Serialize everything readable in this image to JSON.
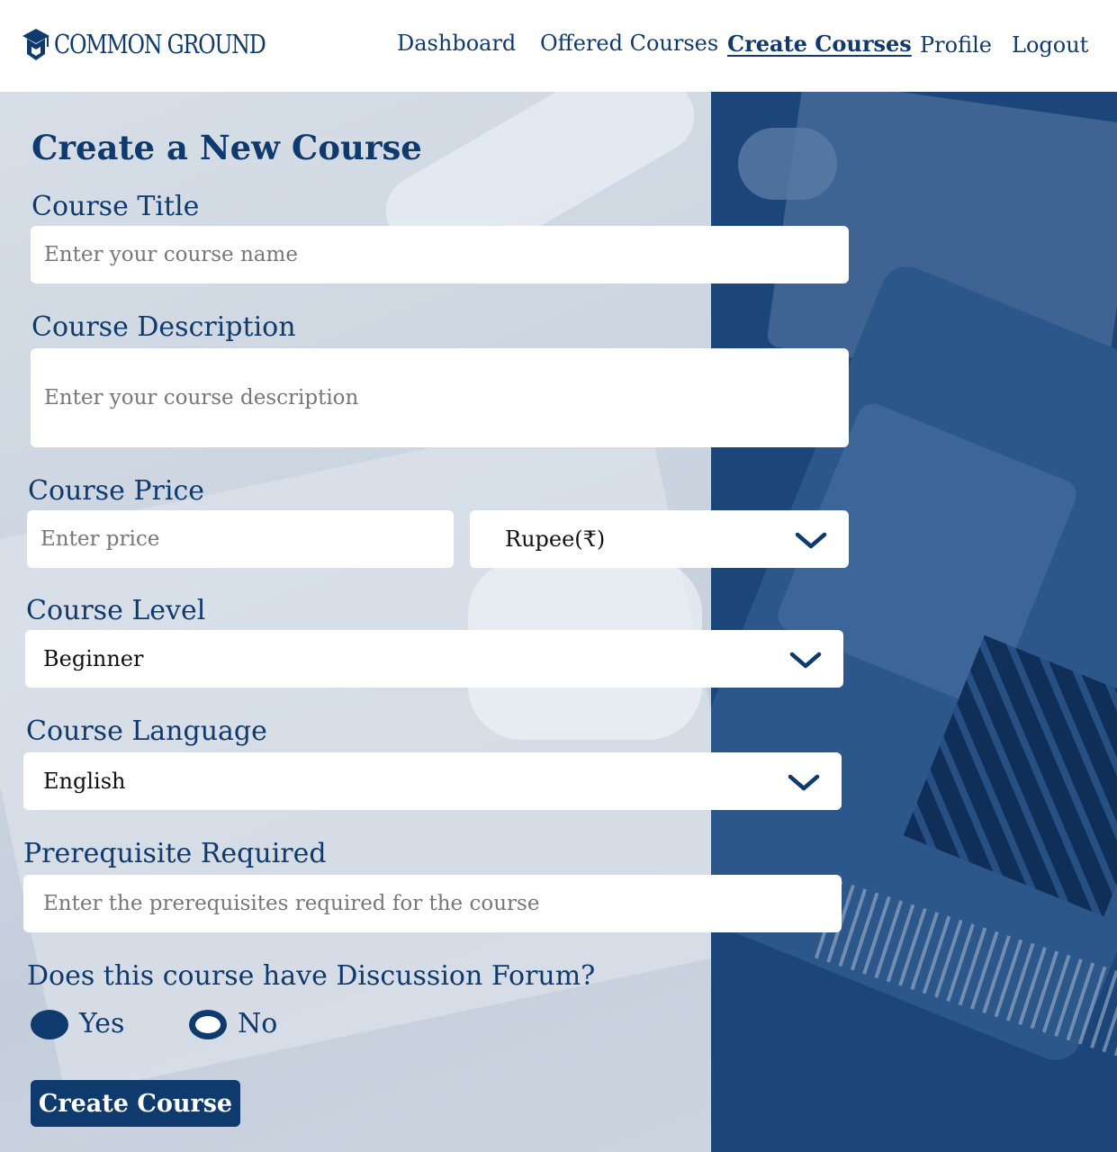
{
  "brand": {
    "name": "COMMON GROUND"
  },
  "nav": {
    "dashboard": "Dashboard",
    "offered_courses": "Offered Courses",
    "create_courses": "Create Courses",
    "profile": "Profile",
    "logout": "Logout"
  },
  "form": {
    "heading": "Create a New Course",
    "course_title": {
      "label": "Course Title",
      "placeholder": "Enter your course name"
    },
    "course_description": {
      "label": "Course Description",
      "placeholder": "Enter your course description"
    },
    "course_price": {
      "label": "Course Price",
      "placeholder": "Enter price",
      "currency": "Rupee(₹)"
    },
    "course_level": {
      "label": "Course Level",
      "value": "Beginner"
    },
    "course_language": {
      "label": "Course Language",
      "value": "English"
    },
    "prerequisite": {
      "label": "Prerequisite Required",
      "placeholder": "Enter the prerequisites required for the course"
    },
    "discussion_forum": {
      "question": "Does this course have Discussion Forum?",
      "yes": "Yes",
      "no": "No",
      "selected": "Yes"
    },
    "submit": "Create Course"
  },
  "colors": {
    "primary": "#0f3a6e",
    "panel_right": "#1c467a",
    "panel_left": "#d0d8e2"
  },
  "icons": [
    "graduation-cap-icon",
    "chevron-down-icon"
  ]
}
